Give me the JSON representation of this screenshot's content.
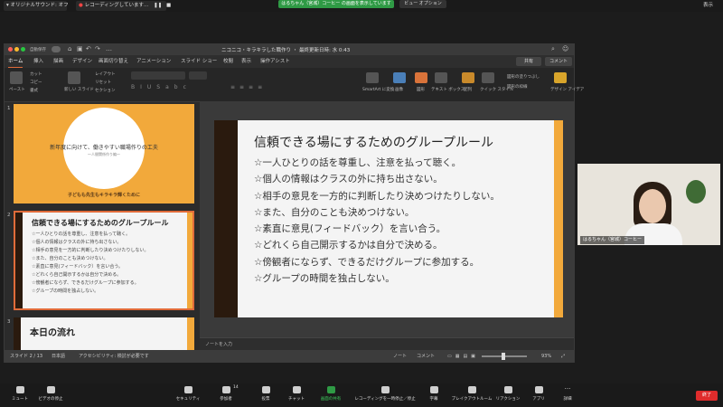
{
  "zoom_top": {
    "audio_label": "オリジナルサウンド: オフ",
    "recording_label": "レコーディングしています...",
    "share_banner": "はるちゃん（宮城）コーヒー の画面を表示しています",
    "view_options": "ビュー オプション",
    "view_label": "表示"
  },
  "ppt": {
    "autosave": "自動保存",
    "doc_title": "ニコニコ・キラキラした職作り ・ 最終更新日時: 水 0:43",
    "ribbon_tabs": [
      "ホーム",
      "挿入",
      "描画",
      "デザイン",
      "画面切り替え",
      "アニメーション",
      "スライド ショー",
      "校閲",
      "表示",
      "操作アシスト"
    ],
    "share_btn": "共有",
    "comment_btn": "コメント",
    "ribbon_groups": {
      "paste": "ペースト",
      "cut": "カット",
      "copy": "コピー",
      "format": "書式",
      "new_slide": "新しい スライド",
      "layout": "レイアウト",
      "reset": "リセット",
      "section": "セクション",
      "smartart": "SmartArt に変換",
      "picture": "画像",
      "shapes": "図形",
      "textbox": "テキスト ボックス",
      "arrange": "配列",
      "quick_style": "クイック スタイル",
      "fill": "図形の塗りつぶし",
      "outline": "図形の枠線",
      "design_ideas": "デザイン アイデア"
    },
    "thumbs": [
      {
        "num": "1",
        "title": "新年度に向けて、働きやすい職場作りの工夫",
        "subtitle": "〜人間関係作り編〜",
        "footer": "子どもも先生もキラキラ輝くために"
      },
      {
        "num": "2",
        "title": "信頼できる場にするためのグループルール"
      },
      {
        "num": "3",
        "title": "本日の流れ"
      }
    ],
    "slide": {
      "title": "信頼できる場にするためのグループルール",
      "bullets": [
        "☆一人ひとりの話を尊重し、注意を払って聴く。",
        "☆個人の情報はクラスの外に持ち出さない。",
        "☆相手の意見を一方的に判断したり決めつけたりしない。",
        "☆また、自分のことも決めつけない。",
        "☆素直に意見(フィードバック）を言い合う。",
        "☆どれくら自己開示するかは自分で決める。",
        "☆傍観者にならず、できるだけグループに参加する。",
        "☆グループの時間を独占しない。"
      ]
    },
    "notes_placeholder": "ノートを入力",
    "status": {
      "slide_info": "スライド 2 / 13",
      "language": "日本語",
      "accessibility": "アクセシビリティ: 検討が必要です",
      "notes": "ノート",
      "comments": "コメント",
      "zoom": "93%"
    }
  },
  "video": {
    "name": "はるちゃん（宮城）コーヒー"
  },
  "toolbar": {
    "items": [
      {
        "label": "ミュート",
        "icon": "microphone-icon"
      },
      {
        "label": "ビデオの停止",
        "icon": "video-camera-icon"
      },
      {
        "label": "セキュリティ",
        "icon": "shield-icon"
      },
      {
        "label": "参加者",
        "icon": "participants-icon",
        "badge": "14"
      },
      {
        "label": "投票",
        "icon": "poll-icon"
      },
      {
        "label": "チャット",
        "icon": "chat-icon"
      },
      {
        "label": "画面の共有",
        "icon": "share-screen-icon"
      },
      {
        "label": "レコーディングを一時停止／停止",
        "icon": "record-icon"
      },
      {
        "label": "字幕",
        "icon": "captions-icon"
      },
      {
        "label": "ブレイクアウトルーム",
        "icon": "breakout-icon"
      },
      {
        "label": "リアクション",
        "icon": "reaction-icon"
      },
      {
        "label": "アプリ",
        "icon": "apps-icon"
      },
      {
        "label": "詳細",
        "icon": "more-icon"
      }
    ],
    "leave": "終了"
  },
  "colors": {
    "slide_accent": "#f2a93b",
    "slide_dark": "#2a1a0e",
    "share_green": "#2f9a45",
    "leave_red": "#e02c2c"
  }
}
